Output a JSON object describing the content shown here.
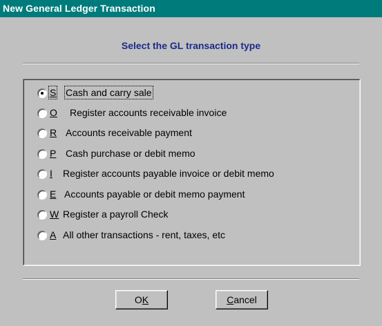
{
  "window": {
    "title": "New General Ledger Transaction"
  },
  "heading": "Select the GL transaction type",
  "options": [
    {
      "key": "S",
      "label": "Cash and carry sale",
      "checked": true
    },
    {
      "key": "O",
      "label": "Register accounts receivable invoice",
      "checked": false
    },
    {
      "key": "R",
      "label": "Accounts receivable payment",
      "checked": false
    },
    {
      "key": "P",
      "label": "Cash purchase or debit memo",
      "checked": false
    },
    {
      "key": "I",
      "label": "Register accounts payable invoice or debit memo",
      "checked": false
    },
    {
      "key": "E",
      "label": "Accounts payable or debit memo payment",
      "checked": false
    },
    {
      "key": "W",
      "label": "Register a payroll Check",
      "checked": false
    },
    {
      "key": "A",
      "label": "All other transactions - rent, taxes, etc",
      "checked": false
    }
  ],
  "buttons": {
    "ok": {
      "mnemonic": "K",
      "rest_before": "O",
      "rest_after": ""
    },
    "cancel": {
      "mnemonic": "C",
      "rest_before": "",
      "rest_after": "ancel"
    }
  }
}
